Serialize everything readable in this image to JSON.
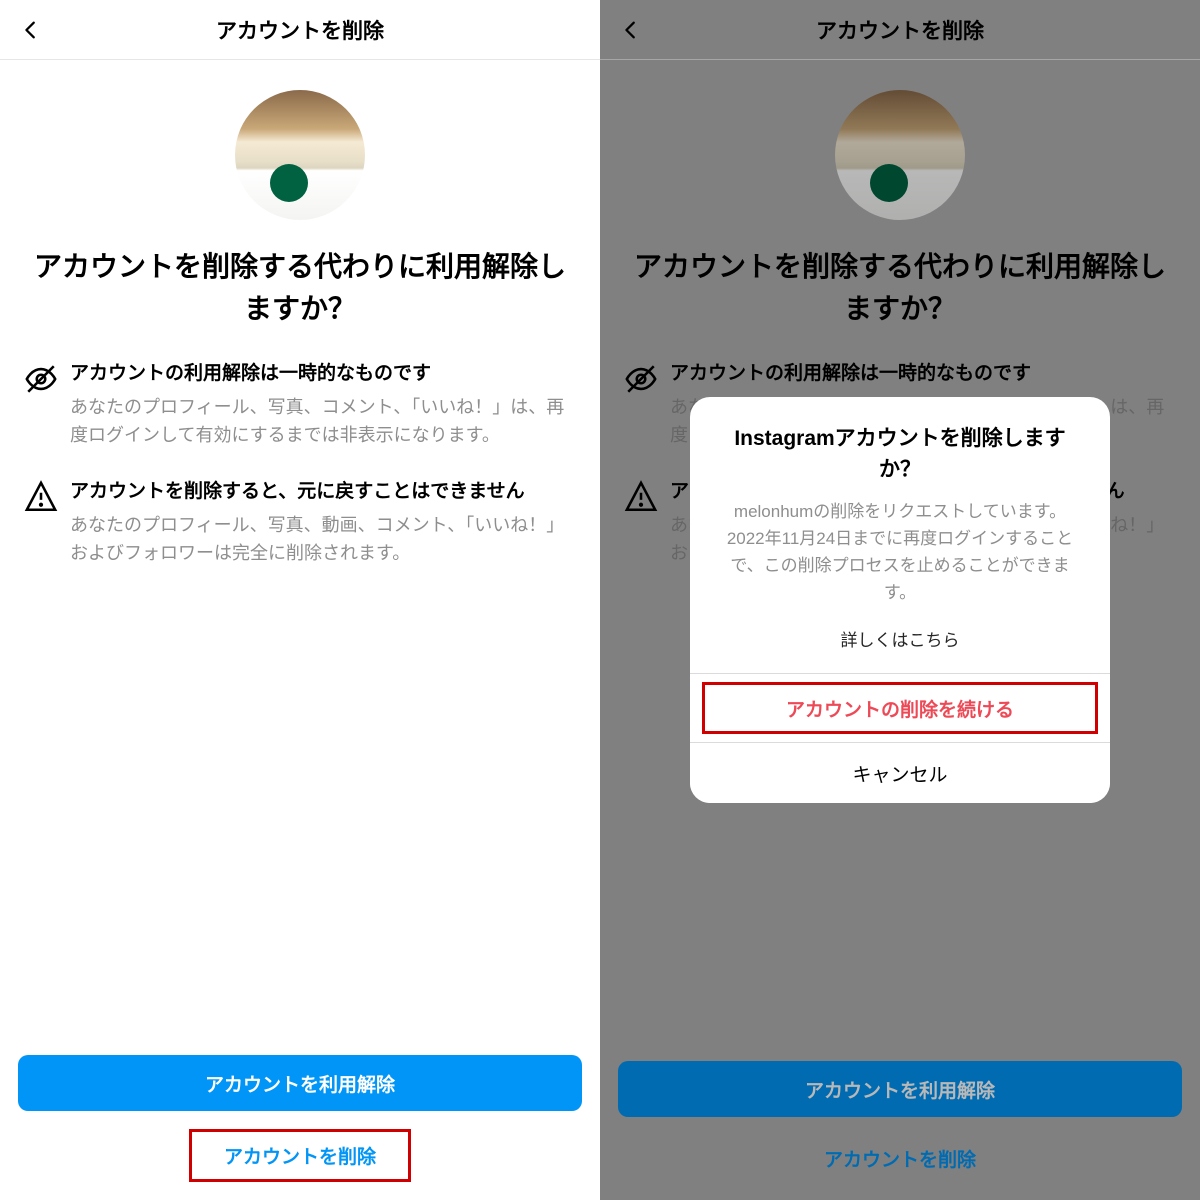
{
  "left": {
    "header_title": "アカウントを削除",
    "headline": "アカウントを削除する代わりに利用解除しますか？",
    "info1_title": "アカウントの利用解除は一時的なものです",
    "info1_body": "あなたのプロフィール、写真、コメント、「いいね！」は、再度ログインして有効にするまでは非表示になります。",
    "info2_title": "アカウントを削除すると、元に戻すことはできません",
    "info2_body": "あなたのプロフィール、写真、動画、コメント、「いいね！」およびフォロワーは完全に削除されます。",
    "btn_deactivate": "アカウントを利用解除",
    "btn_delete": "アカウントを削除"
  },
  "right": {
    "header_title": "アカウントを削除",
    "headline": "アカウントを削除する代わりに利用解除しますか？",
    "info1_title": "アカウントの利用解除は一時的なものです",
    "info1_body": "あなたのプロフィール、写真、コメント、「いいね！」は、再度ログインして有効にするまでは非表示になります。",
    "info2_title": "アカウントを削除すると、元に戻すことはできません",
    "info2_body": "あなたのプロフィール、写真、動画、コメント、「いいね！」およびフォロワーは完全に削除されます。",
    "btn_deactivate": "アカウントを利用解除",
    "btn_delete": "アカウントを削除",
    "modal_title": "Instagramアカウントを削除しますか？",
    "modal_body": "melonhumの削除をリクエストしています。2022年11月24日までに再度ログインすることで、この削除プロセスを止めることができます。",
    "modal_learnmore": "詳しくはこちら",
    "modal_continue": "アカウントの削除を続ける",
    "modal_cancel": "キャンセル"
  }
}
